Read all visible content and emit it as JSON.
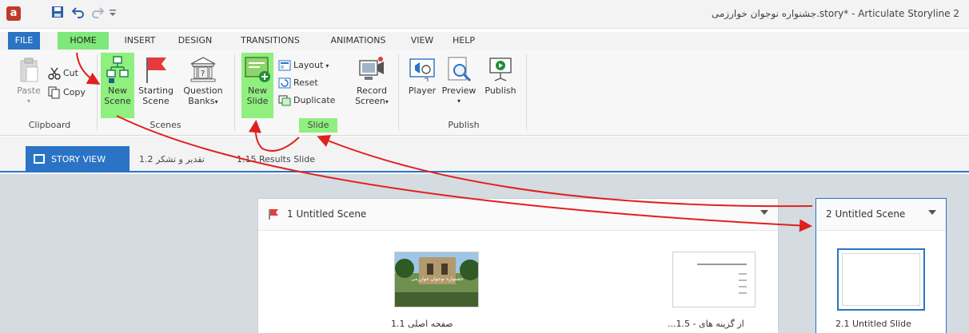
{
  "window": {
    "title": "جشنواره نوجوان خوارزمی.story* - Articulate Storyline 2",
    "app_icon": "a",
    "qat": [
      "save-icon",
      "undo-icon",
      "redo-icon",
      "customize-icon"
    ]
  },
  "tabs": [
    "FILE",
    "HOME",
    "INSERT",
    "DESIGN",
    "TRANSITIONS",
    "ANIMATIONS",
    "VIEW",
    "HELP"
  ],
  "ribbon": {
    "clipboard": {
      "paste": "Paste",
      "cut": "Cut",
      "copy": "Copy",
      "label": "Clipboard"
    },
    "scenes": {
      "new_scene_1": "New",
      "new_scene_2": "Scene",
      "starting_scene_1": "Starting",
      "starting_scene_2": "Scene",
      "question_banks_1": "Question",
      "question_banks_2": "Banks",
      "label": "Scenes"
    },
    "slide": {
      "new_slide_1": "New",
      "new_slide_2": "Slide",
      "layout": "Layout",
      "reset": "Reset",
      "duplicate": "Duplicate",
      "label": "Slide"
    },
    "record": {
      "record_1": "Record",
      "record_2": "Screen"
    },
    "publish": {
      "player": "Player",
      "preview": "Preview",
      "publish": "Publish",
      "label": "Publish"
    }
  },
  "viewbar": {
    "story_view": "STORY VIEW",
    "tab_1": "تقدیر و تشکر 1.2",
    "tab_2": "1.15 Results Slide"
  },
  "scenes": [
    {
      "title": "1 Untitled Scene",
      "slides": [
        {
          "caption": "صفحه اصلی 1.1",
          "thumb_text": "جشنواره نوجوان خوارزمی"
        },
        {
          "caption": "...از گزینه های  - 1.5"
        }
      ]
    },
    {
      "title": "2 Untitled Scene",
      "slides": [
        {
          "caption": "2.1 Untitled Slide"
        }
      ]
    }
  ],
  "colors": {
    "accent": "#2a73c5",
    "highlight": "#8ff07f",
    "arrow": "#e0201e",
    "canvas": "#d4dbe1"
  }
}
